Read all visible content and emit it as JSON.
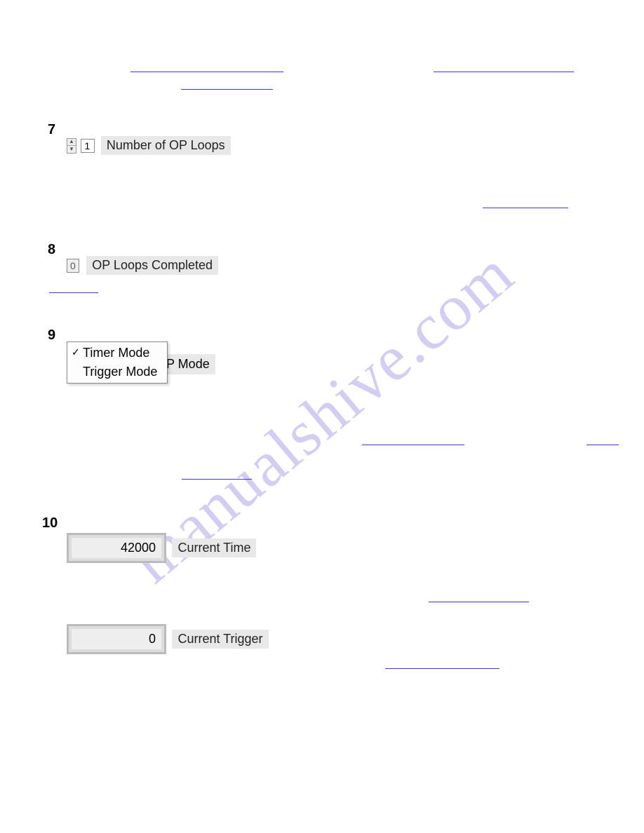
{
  "watermark": "manualshive.com",
  "items": {
    "7": {
      "number": "7",
      "spinner_value": "1",
      "label": "Number of OP Loops"
    },
    "8": {
      "number": "8",
      "value": "0",
      "label": "OP Loops Completed"
    },
    "9": {
      "number": "9",
      "options": [
        "Timer Mode",
        "Trigger Mode"
      ],
      "selected_index": 0,
      "back_label": "OP Mode"
    },
    "10": {
      "number": "10",
      "current_time_value": "42000",
      "current_time_label": "Current Time",
      "current_trigger_value": "0",
      "current_trigger_label": "Current Trigger"
    }
  }
}
